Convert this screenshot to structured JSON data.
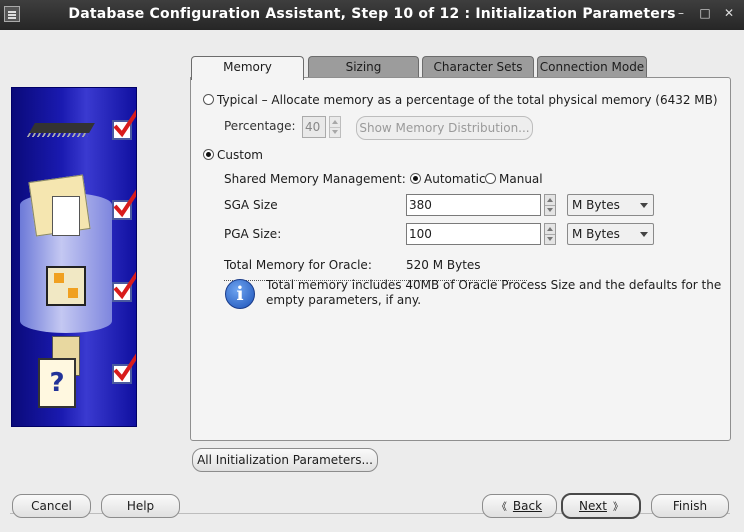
{
  "window": {
    "title": "Database Configuration Assistant, Step 10 of 12 : Initialization Parameters",
    "controls": [
      "–",
      "□",
      "✕"
    ]
  },
  "tabs": [
    {
      "label": "Memory",
      "active": true
    },
    {
      "label": "Sizing",
      "active": false
    },
    {
      "label": "Character Sets",
      "active": false
    },
    {
      "label": "Connection Mode",
      "active": false
    }
  ],
  "memory": {
    "typical_label": "Typical – Allocate memory as a percentage of the total physical memory (6432 MB)",
    "typical_selected": false,
    "percentage_label": "Percentage:",
    "percentage_value": "40",
    "show_distribution_label": "Show Memory Distribution...",
    "custom_label": "Custom",
    "custom_selected": true,
    "shared_mgmt_label": "Shared Memory Management:",
    "automatic_label": "Automatic",
    "manual_label": "Manual",
    "shared_mgmt_value": "Automatic",
    "sga_label": "SGA Size",
    "sga_value": "380",
    "sga_unit": "M Bytes",
    "pga_label": "PGA Size:",
    "pga_value": "100",
    "pga_unit": "M Bytes",
    "total_label": "Total Memory for Oracle:",
    "total_value": "520 M Bytes",
    "info_line1": "Total memory includes 40MB of Oracle Process Size and the defaults for the",
    "info_line2": "empty parameters, if any.",
    "info_icon": "i"
  },
  "buttons": {
    "all_params": "All Initialization Parameters...",
    "cancel": "Cancel",
    "help": "Help",
    "back": "Back",
    "back_arrow": "《",
    "next": "Next",
    "next_arrow": "》",
    "finish": "Finish"
  },
  "illustration": {
    "question_glyph": "?"
  },
  "colors": {
    "title_bar": "#2e2e2e",
    "art_blue": "#1a1ab0",
    "check_red": "#d81c1c",
    "info_blue": "#1c52b8"
  }
}
